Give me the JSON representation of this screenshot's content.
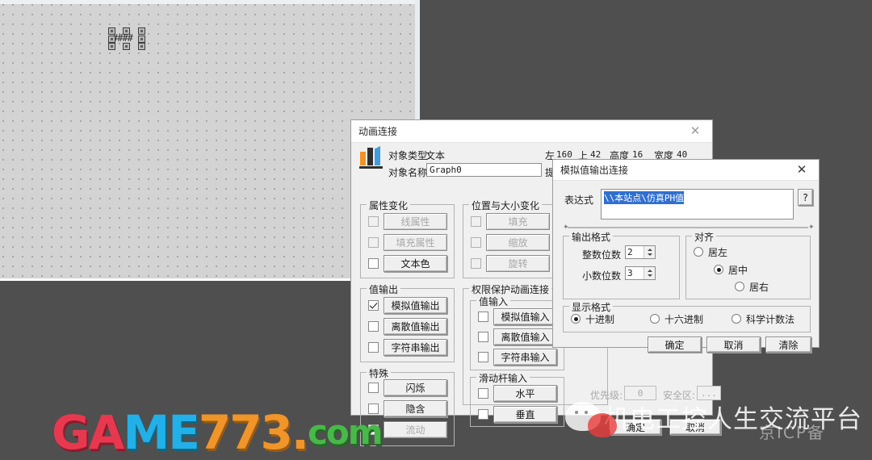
{
  "canvas": {
    "object_text": "####"
  },
  "main_dialog": {
    "title": "动画连接",
    "close_icon": "close-icon",
    "object_type_label": "对象类型:",
    "object_type_value": "文本",
    "object_name_label": "对象名称:",
    "object_name_value": "Graph0",
    "geometry": {
      "left_label": "左",
      "left_value": "160",
      "top_label": "上",
      "top_value": "42",
      "height_label": "高度",
      "height_value": "16",
      "width_label": "宽度",
      "width_value": "40"
    },
    "tip_label": "提",
    "groups": {
      "attribute_change": {
        "legend": "属性变化",
        "items": [
          {
            "label": "线属性",
            "checked": false,
            "disabled": true
          },
          {
            "label": "填充属性",
            "checked": false,
            "disabled": true
          },
          {
            "label": "文本色",
            "checked": false,
            "disabled": false
          }
        ]
      },
      "position_size_change": {
        "legend": "位置与大小变化",
        "items": [
          {
            "label": "填充",
            "checked": false,
            "disabled": true
          },
          {
            "label": "缩放",
            "checked": false,
            "disabled": true
          },
          {
            "label": "旋转",
            "checked": false,
            "disabled": true
          }
        ]
      },
      "value_output": {
        "legend": "值输出",
        "items": [
          {
            "label": "模拟值输出",
            "checked": true,
            "disabled": false
          },
          {
            "label": "离散值输出",
            "checked": false,
            "disabled": false
          },
          {
            "label": "字符串输出",
            "checked": false,
            "disabled": false
          }
        ]
      },
      "permission_protect": {
        "legend": "权限保护动画连接",
        "value_input": {
          "legend": "值输入",
          "items": [
            {
              "label": "模拟值输入",
              "checked": false,
              "disabled": false
            },
            {
              "label": "离散值输入",
              "checked": false,
              "disabled": false
            },
            {
              "label": "字符串输入",
              "checked": false,
              "disabled": false
            }
          ]
        },
        "slider_input": {
          "legend": "滑动杆输入",
          "items": [
            {
              "label": "水平",
              "checked": false,
              "disabled": false
            },
            {
              "label": "垂直",
              "checked": false,
              "disabled": false
            }
          ]
        },
        "priority_label": "优先级:",
        "priority_value": "0",
        "security_label": "安全区:",
        "security_value": "..."
      },
      "special": {
        "legend": "特殊",
        "items": [
          {
            "label": "闪烁",
            "checked": false,
            "disabled": false
          },
          {
            "label": "隐含",
            "checked": false,
            "disabled": false
          },
          {
            "label": "流动",
            "checked": false,
            "disabled": true
          }
        ]
      }
    },
    "ok_label": "确定",
    "cancel_label": "取消"
  },
  "inner_dialog": {
    "title": "模拟值输出连接",
    "close_icon": "close-icon",
    "expression_label": "表达式",
    "expression_value": "\\\\本站点\\仿真PH值",
    "help_label": "?",
    "output_format": {
      "legend": "输出格式",
      "integer_digits_label": "整数位数",
      "integer_digits_value": "2",
      "decimal_digits_label": "小数位数",
      "decimal_digits_value": "3"
    },
    "align": {
      "legend": "对齐",
      "options": [
        {
          "label": "居左",
          "selected": false
        },
        {
          "label": "居中",
          "selected": true
        },
        {
          "label": "居右",
          "selected": false
        }
      ]
    },
    "display_format": {
      "legend": "显示格式",
      "options": [
        {
          "label": "十进制",
          "selected": true
        },
        {
          "label": "十六进制",
          "selected": false
        },
        {
          "label": "科学计数法",
          "selected": false
        }
      ]
    },
    "ok_label": "确定",
    "cancel_label": "取消",
    "clear_label": "清除"
  },
  "watermarks": {
    "wechat_text": "机电工控人生交流平台",
    "game_text_parts": [
      "GA",
      "ME",
      "773",
      ".",
      "com"
    ],
    "corner_text": "京ICP备"
  }
}
